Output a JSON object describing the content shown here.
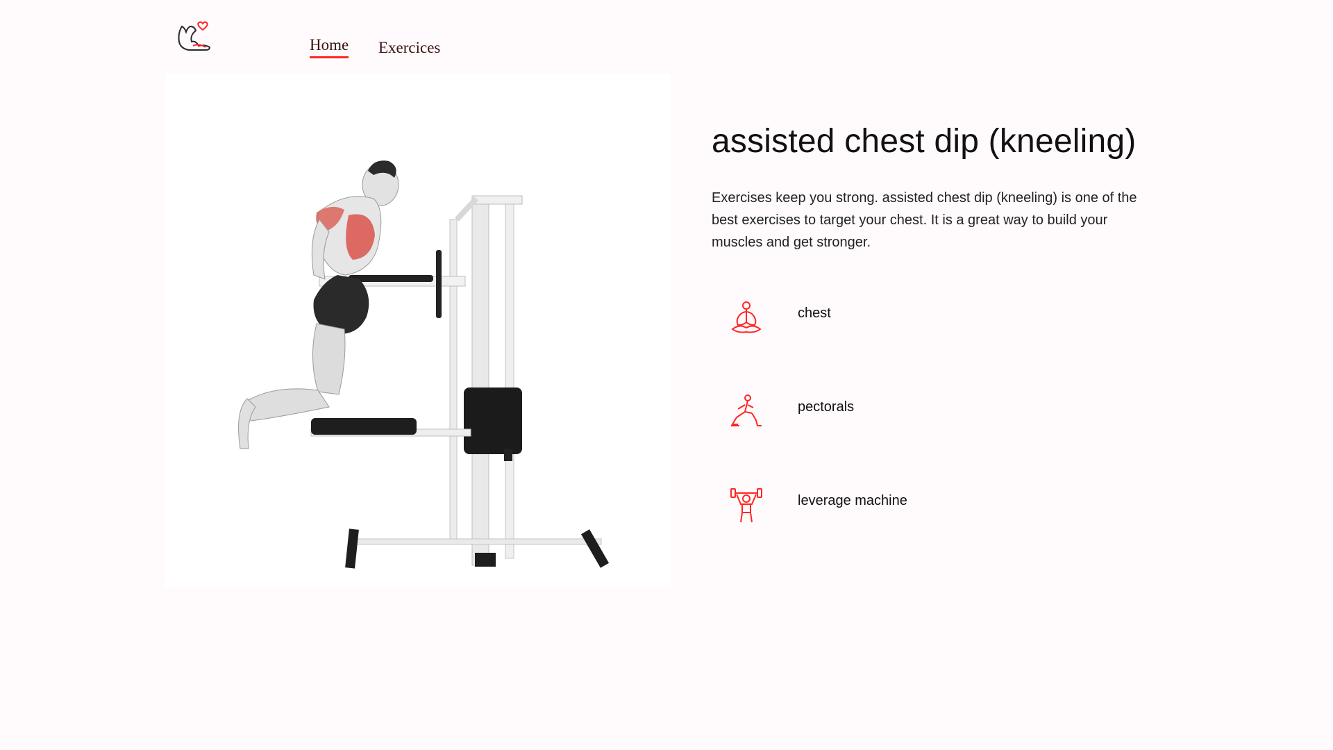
{
  "nav": {
    "logo_icon": "flexed-arm-heart-icon",
    "links": [
      {
        "label": "Home",
        "active": true
      },
      {
        "label": "Exercices",
        "active": false
      }
    ]
  },
  "exercise": {
    "image_alt": "assisted chest dip (kneeling)",
    "title": "assisted chest dip (kneeling)",
    "description": "Exercises keep you strong. assisted chest dip (kneeling) is one of the best exercises to target your chest. It is a great way to build your muscles and get stronger.",
    "extra": [
      {
        "icon": "meditation-body-icon",
        "label": "chest"
      },
      {
        "icon": "lunge-target-icon",
        "label": "pectorals"
      },
      {
        "icon": "weightlifter-equipment-icon",
        "label": "leverage machine"
      }
    ]
  },
  "colors": {
    "accent": "#ff2625",
    "background": "#fffafb",
    "muscle_highlight": "#d9534a"
  }
}
